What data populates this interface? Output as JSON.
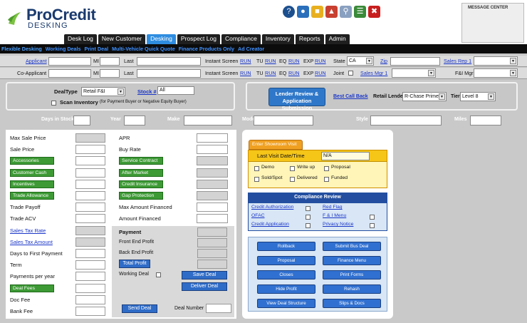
{
  "brand": {
    "name": "ProCredit",
    "sub": "DESKING"
  },
  "header_icons": [
    "help-icon",
    "users-icon",
    "folder-icon",
    "map-icon",
    "search-icon",
    "list-icon",
    "close-icon"
  ],
  "message_center": {
    "title": "MESSAGE CENTER"
  },
  "main_nav": [
    "Desk Log",
    "New Customer",
    "Desking",
    "Prospect Log",
    "Compliance",
    "Inventory",
    "Reports",
    "Admin"
  ],
  "main_nav_active": "Desking",
  "sub_nav": [
    "Flexible Desking",
    "Working Deals",
    "Print Deal",
    "Multi-Vehicle Quick Quote",
    "Finance Products Only",
    "Ad Creator"
  ],
  "customer_rows": [
    {
      "who": "Applicant",
      "mi": "MI",
      "last": "Last",
      "instant": "Instant Screen",
      "run": "RUN",
      "tu": "TU",
      "eq": "EQ",
      "exp": "EXP",
      "extra_label": "State",
      "extra_value": "CA",
      "zip": "Zip",
      "rep": "Sales Rep 1"
    },
    {
      "who": "Co-Applicant",
      "mi": "MI",
      "last": "Last",
      "instant": "Instant Screen",
      "run": "RUN",
      "tu": "TU",
      "eq": "EQ",
      "exp": "EXP",
      "extra_label": "Joint",
      "extra_value": "",
      "zip": "",
      "rep": "Sales Mgr 1",
      "mgr": "F&I Mgr"
    }
  ],
  "deal": {
    "deal_type_label": "DealType",
    "deal_type_value": "Retail F&I",
    "stock_label": "Stock #",
    "stock_value": "All",
    "scan_label": "Scan Inventory",
    "scan_note": "(for Payment Buyer or Negative Equity Buyer)"
  },
  "lender": {
    "button": "Lender Review & Application Submission",
    "best_call_back": "Best Call Back",
    "retail_lender_label": "Retail Lender",
    "retail_lender_value": "R-Chase Prime",
    "tier_label": "Tier",
    "tier_value": "Level 8"
  },
  "vehicle_bar": {
    "days_in_stock": "Days in Stock",
    "year": "Year",
    "make": "Make",
    "model": "Model",
    "style": "Style",
    "miles": "Miles"
  },
  "left_fields": [
    {
      "label": "Max Sale Price",
      "style": "plain"
    },
    {
      "label": "Sale Price",
      "style": "plain"
    },
    {
      "label": "Accessories",
      "style": "green"
    },
    {
      "label": "Customer Cash",
      "style": "green"
    },
    {
      "label": "Incentives",
      "style": "green"
    },
    {
      "label": "Trade Allowance",
      "style": "green"
    },
    {
      "label": "Trade Payoff",
      "style": "plain"
    },
    {
      "label": "Trade ACV",
      "style": "plain"
    },
    {
      "label": "Sales Tax Rate",
      "style": "link"
    },
    {
      "label": "Sales Tax Amount",
      "style": "link"
    },
    {
      "label": "Days to First Payment",
      "style": "plain"
    },
    {
      "label": "Term",
      "style": "plain"
    },
    {
      "label": "Payments per year",
      "style": "plain"
    },
    {
      "label": "Deal Fees",
      "style": "green"
    },
    {
      "label": "Doc Fee",
      "style": "plain"
    },
    {
      "label": "Bank Fee",
      "style": "plain"
    }
  ],
  "mid_fields": [
    {
      "label": "APR",
      "style": "plain"
    },
    {
      "label": "Buy Rate",
      "style": "plain"
    },
    {
      "label": "Service Contract",
      "style": "green"
    },
    {
      "label": "After Market",
      "style": "green"
    },
    {
      "label": "Credit Insurance",
      "style": "green"
    },
    {
      "label": "Gap Protection",
      "style": "green"
    },
    {
      "label": "Max Amount Financed",
      "style": "plain"
    },
    {
      "label": "Amount Financed",
      "style": "plain"
    }
  ],
  "payment": {
    "title": "Payment",
    "front_end": "Front End Profit",
    "back_end": "Back End Profit",
    "total_profit": "Total Profit",
    "working_deal": "Working Deal",
    "save_deal": "Save Deal",
    "deliver_deal": "Deliver Deal",
    "send_deal": "Send Deal",
    "deal_number": "Deal Number"
  },
  "showroom": {
    "tab": "Enter Showroom Visit",
    "last_visit_label": "Last Visit Date/Time",
    "last_visit_value": "N/A",
    "checks": [
      "Demo",
      "Write up",
      "Proposal",
      "Sold/Spot",
      "Delivered",
      "Funded"
    ]
  },
  "compliance": {
    "title": "Compliance Review",
    "items": [
      "Credit Authorization",
      "Red Flag",
      "OFAC",
      "F & I Menu",
      "Credit Application",
      "Privacy Notice"
    ]
  },
  "actions": [
    "Rollback",
    "Submit Bus Deal",
    "Proposal",
    "Finance Menu",
    "Closes",
    "Print Forms",
    "Hide Profit",
    "Rehash",
    "View Deal Structure",
    "Slips & Docs"
  ],
  "colors": {
    "accent": "#2f8de0",
    "green_button": "#3d9a35",
    "blue_button": "#2f6cc7",
    "showroom_tab": "#f0a020",
    "compliance": "#244fa0"
  }
}
